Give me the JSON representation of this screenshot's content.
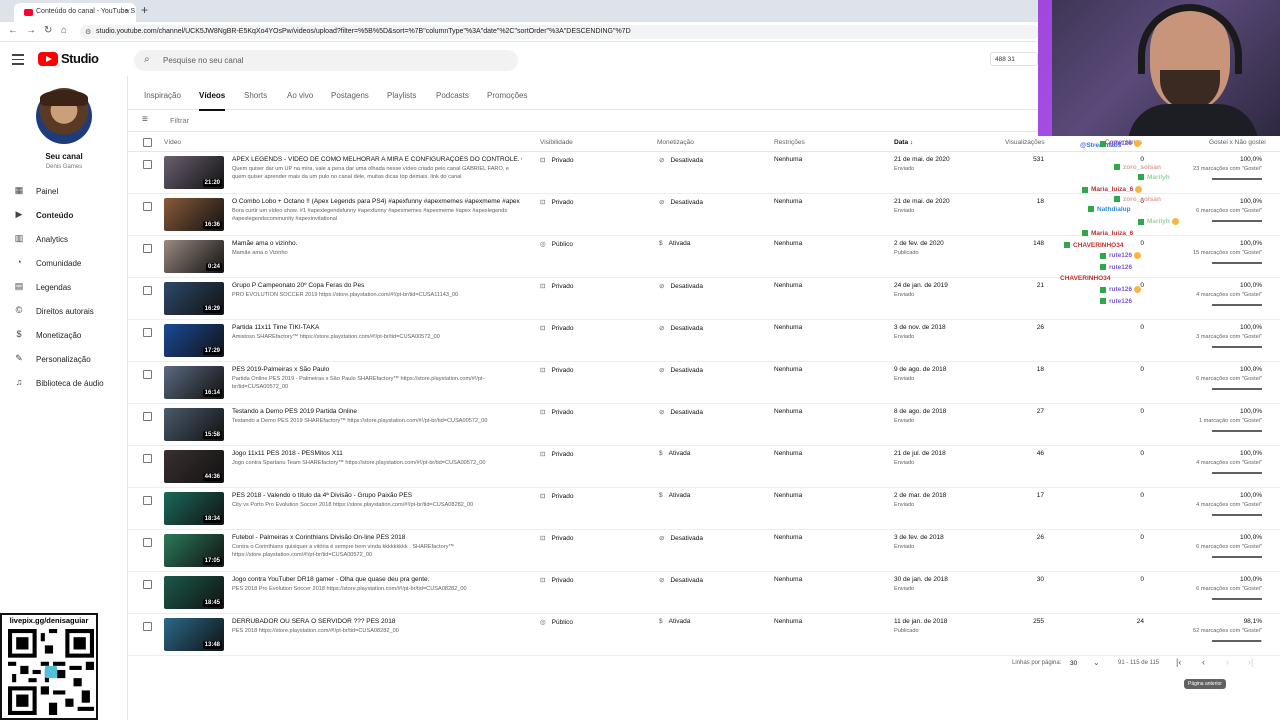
{
  "browser": {
    "tab_title": "Conteúdo do canal - YouTube S",
    "url": "studio.youtube.com/channel/UCK5JW8NgBR-E5KqXo4YOsPw/videos/upload?filter=%5B%5D&sort=%7B\"columnType\"%3A\"date\"%2C\"sortOrder\"%3A\"DESCENDING\"%7D"
  },
  "header": {
    "logo_text": "Studio",
    "search_placeholder": "Pesquise no seu canal",
    "stats": "488  31"
  },
  "sidebar": {
    "channel_label": "Seu canal",
    "channel_name": "Denis Games",
    "items": [
      {
        "label": "Painel",
        "icon": "dashboard-icon"
      },
      {
        "label": "Conteúdo",
        "icon": "content-icon",
        "active": true
      },
      {
        "label": "Analytics",
        "icon": "analytics-icon"
      },
      {
        "label": "Comunidade",
        "icon": "community-icon"
      },
      {
        "label": "Legendas",
        "icon": "subtitles-icon"
      },
      {
        "label": "Direitos autorais",
        "icon": "copyright-icon"
      },
      {
        "label": "Monetização",
        "icon": "monetization-icon"
      },
      {
        "label": "Personalização",
        "icon": "customization-icon"
      },
      {
        "label": "Biblioteca de áudio",
        "icon": "audio-library-icon"
      }
    ]
  },
  "content_tabs": [
    "Inspiração",
    "Vídeos",
    "Shorts",
    "Ao vivo",
    "Postagens",
    "Playlists",
    "Podcasts",
    "Promoções"
  ],
  "active_tab": "Vídeos",
  "filter_label": "Filtrar",
  "columns": {
    "video": "Vídeo",
    "visibility": "Visibilidade",
    "monetization": "Monetização",
    "restrictions": "Restrições",
    "date": "Data",
    "views": "Visualizações",
    "comments": "Comentários",
    "likes": "Gostei x Não gostei"
  },
  "rows": [
    {
      "title": "APEX LEGENDS - VÍDEO DE COMO MELHORAR A MIRA E CONFIGURAÇÕES DO CONTROLE. CANA...",
      "desc": "Quem quiser dar um UP na mira, vale a pena dar uma olhada nesse vídeo criado pelo canal GABRIEL FARO, e quem quiser aprender mais da um pulo no canal dele, muitas dicas top demais. link do canal",
      "duration": "21:20",
      "visibility": "Privado",
      "monetization": "Desativada",
      "restrictions": "Nenhuma",
      "date": "21 de mai. de 2020",
      "status": "Enviado",
      "views": "531",
      "comments": "0",
      "likes": "100,0%",
      "likes_sub": "23 marcações com \"Gostei\"",
      "like_ratio": 1.0,
      "thumb_color": "#6a6070"
    },
    {
      "title": "O Combo Lobo + Octano !! (Apex Legends para PS4) #apexfunny #apexmemes #apexmeme #apex",
      "desc": "Bora curtir um vídeo show. #1 #apexlegendsfunny #apexfunny #apexmemes #apexmeme #apex #apexlegends #apexlegendscommunity #apexinvitational",
      "duration": "16:36",
      "visibility": "Privado",
      "monetization": "Desativada",
      "restrictions": "Nenhuma",
      "date": "21 de mai. de 2020",
      "status": "Enviado",
      "views": "18",
      "comments": "0",
      "likes": "100,0%",
      "likes_sub": "6 marcações com \"Gostei\"",
      "like_ratio": 1.0,
      "thumb_color": "#8a5a3a"
    },
    {
      "title": "Mamãe ama o vizinho.",
      "desc": "Mamãe ama o Vizinho",
      "duration": "0:24",
      "visibility": "Público",
      "monetization": "Ativada",
      "restrictions": "Nenhuma",
      "date": "2 de fev. de 2020",
      "status": "Publicado",
      "views": "148",
      "comments": "0",
      "likes": "100,0%",
      "likes_sub": "15 marcações com \"Gostei\"",
      "like_ratio": 1.0,
      "thumb_color": "#9a8a80"
    },
    {
      "title": "Grupo P Campeonato 20º Copa Feras do Pes",
      "desc": "PRO EVOLUTION SOCCER 2019 https://store.playstation.com/#!/pt-br/tid=CUSA11143_00",
      "duration": "16:29",
      "visibility": "Privado",
      "monetization": "Desativada",
      "restrictions": "Nenhuma",
      "date": "24 de jan. de 2019",
      "status": "Enviado",
      "views": "21",
      "comments": "0",
      "likes": "100,0%",
      "likes_sub": "4 marcações com \"Gostei\"",
      "like_ratio": 1.0,
      "thumb_color": "#2d4a6a"
    },
    {
      "title": "Partida 11x11 Time TIKI-TAKA",
      "desc": "Amistoso SHAREfactory™ https://store.playstation.com/#!/pt-br/tid=CUSA00572_00",
      "duration": "17:29",
      "visibility": "Privado",
      "monetization": "Desativada",
      "restrictions": "Nenhuma",
      "date": "3 de nov. de 2018",
      "status": "Enviado",
      "views": "26",
      "comments": "0",
      "likes": "100,0%",
      "likes_sub": "3 marcações com \"Gostei\"",
      "like_ratio": 1.0,
      "thumb_color": "#1a4a9a"
    },
    {
      "title": "PES 2019-Palmeiras x São Paulo",
      "desc": "Partida Online PES 2019 - Palmeiras x São Paulo SHAREfactory™ https://store.playstation.com/#!/pt-br/tid=CUSA00572_00",
      "duration": "16:14",
      "visibility": "Privado",
      "monetization": "Desativada",
      "restrictions": "Nenhuma",
      "date": "9 de ago. de 2018",
      "status": "Enviado",
      "views": "18",
      "comments": "0",
      "likes": "100,0%",
      "likes_sub": "6 marcações com \"Gostei\"",
      "like_ratio": 1.0,
      "thumb_color": "#5a6a80"
    },
    {
      "title": "Testando a Demo PES 2019 Partida Online",
      "desc": "Testando a Demo PES 2019 SHAREfactory™ https://store.playstation.com/#!/pt-br/tid=CUSA00572_00",
      "duration": "15:58",
      "visibility": "Privado",
      "monetization": "Desativada",
      "restrictions": "Nenhuma",
      "date": "8 de ago. de 2018",
      "status": "Enviado",
      "views": "27",
      "comments": "0",
      "likes": "100,0%",
      "likes_sub": "1 marcação com \"Gostei\"",
      "like_ratio": 1.0,
      "thumb_color": "#4a5a6a"
    },
    {
      "title": "Jogo 11x11 PES 2018 - PESMitos X11",
      "desc": "Jogo contra Spartanu Team SHAREfactory™ https://store.playstation.com/#!/pt-br/tid=CUSA00572_00",
      "duration": "44:36",
      "visibility": "Privado",
      "monetization": "Ativada",
      "restrictions": "Nenhuma",
      "date": "21 de jul. de 2018",
      "status": "Enviado",
      "views": "46",
      "comments": "0",
      "likes": "100,0%",
      "likes_sub": "4 marcações com \"Gostei\"",
      "like_ratio": 1.0,
      "thumb_color": "#3a3030"
    },
    {
      "title": "PES 2018 - Valendo o título da 4ª Divisão - Grupo Paixão PES",
      "desc": "City vs Porto Pro Evolution Soccer 2018 https://store.playstation.com/#!/pt-br/tid=CUSA08282_00",
      "duration": "18:34",
      "visibility": "Privado",
      "monetization": "Ativada",
      "restrictions": "Nenhuma",
      "date": "2 de mar. de 2018",
      "status": "Enviado",
      "views": "17",
      "comments": "0",
      "likes": "100,0%",
      "likes_sub": "4 marcações com \"Gostei\"",
      "like_ratio": 1.0,
      "thumb_color": "#1a6a5a"
    },
    {
      "title": "Futebol - Palmeiras x CorinthIans Divisão On-line PES 2018",
      "desc": "Contra o Corinthians quisiquer a vitória é sempre bem vinda kkkkkkkkk . SHAREfactory™ https://store.playstation.com/#!/pt-br/tid=CUSA00572_00",
      "duration": "17:05",
      "visibility": "Privado",
      "monetization": "Desativada",
      "restrictions": "Nenhuma",
      "date": "3 de fev. de 2018",
      "status": "Enviado",
      "views": "26",
      "comments": "0",
      "likes": "100,0%",
      "likes_sub": "6 marcações com \"Gostei\"",
      "like_ratio": 1.0,
      "thumb_color": "#2a7a5a"
    },
    {
      "title": "Jogo contra YouTuber DR18 gamer - Olha que quase deu pra gente.",
      "desc": "PES 2018 Pro Evolution Soccer 2018 https://store.playstation.com/#!/pt-br/tid=CUSA08282_00",
      "duration": "18:45",
      "visibility": "Privado",
      "monetization": "Desativada",
      "restrictions": "Nenhuma",
      "date": "30 de jan. de 2018",
      "status": "Enviado",
      "views": "30",
      "comments": "0",
      "likes": "100,0%",
      "likes_sub": "6 marcações com \"Gostei\"",
      "like_ratio": 1.0,
      "thumb_color": "#1a5a4a"
    },
    {
      "title": "DERRUBADOR OU SERÁ O SERVIDOR ??? PES 2018",
      "desc": "PES 2018 https://store.playstation.com/#!/pt-br/tid=CUSA08282_00",
      "duration": "13:48",
      "visibility": "Público",
      "monetization": "Ativada",
      "restrictions": "Nenhuma",
      "date": "11 de jan. de 2018",
      "status": "Publicado",
      "views": "255",
      "comments": "24",
      "likes": "98,1%",
      "likes_sub": "52 marcações com \"Gostei\"",
      "like_ratio": 0.981,
      "thumb_color": "#2a6a8a"
    }
  ],
  "pagination": {
    "rows_label": "Linhas por página:",
    "rows_value": "30",
    "range": "91 - 115 de 115",
    "tooltip": "Página anterior"
  },
  "chat": [
    {
      "user": "@Streamlabs",
      "color": "#3a6ad4",
      "badge": false
    },
    {
      "user": "rute126",
      "color": "#7a5ad4",
      "badge": true
    },
    {
      "user": "zoro_solsan",
      "color": "#e0a0a0",
      "badge": true
    },
    {
      "user": "Marilyh",
      "color": "#9ad4a0",
      "badge": true
    },
    {
      "user": "Maria_luiza_6",
      "color": "#c03030",
      "badge": true
    },
    {
      "user": "zoro_solsan",
      "color": "#e0a0a0",
      "badge": true
    },
    {
      "user": "Nathdialup",
      "color": "#3a8ad4",
      "badge": true
    },
    {
      "user": "Marilyh",
      "color": "#9ad4a0",
      "badge": true
    },
    {
      "user": "Maria_luiza_6",
      "color": "#c03030",
      "badge": true
    },
    {
      "user": "CHAVERINHO34",
      "color": "#c03030",
      "badge": true
    },
    {
      "user": "rute126",
      "color": "#7a5ad4",
      "badge": true
    },
    {
      "user": "rute126",
      "color": "#7a5ad4",
      "badge": true
    },
    {
      "user": "CHAVERINHO34",
      "color": "#c03030",
      "badge": false
    },
    {
      "user": "rute126",
      "color": "#7a5ad4",
      "badge": true
    },
    {
      "user": "rute126",
      "color": "#7a5ad4",
      "badge": true
    }
  ],
  "qr_label": "livepix.gg/denisaguiar"
}
